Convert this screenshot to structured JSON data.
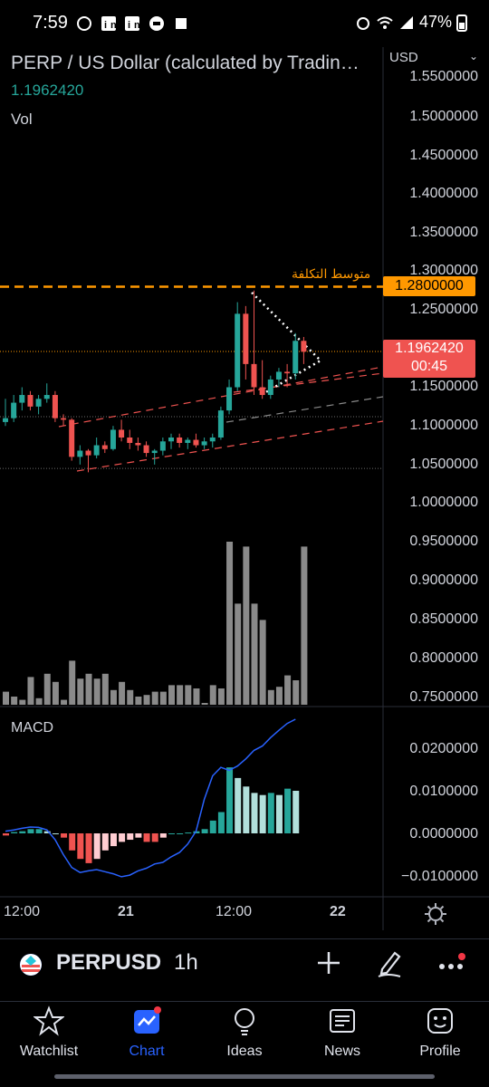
{
  "status_bar": {
    "time": "7:59",
    "notification_icons": [
      "whatsapp-icon",
      "linkedin-icon",
      "linkedin-icon",
      "message-icon",
      "puzzle-icon"
    ],
    "battery": "47%"
  },
  "chart": {
    "title": "PERP / US Dollar (calculated by Tradin…",
    "last_price": "1.1962420",
    "volume_label": "Vol",
    "macd_label": "MACD",
    "currency": "USD",
    "cost_label": "متوسط التكلفة",
    "cost_price": "1.2800000",
    "last_badge_price": "1.1962420",
    "countdown": "00:45",
    "price_axis": [
      "1.5500000",
      "1.5000000",
      "1.4500000",
      "1.4000000",
      "1.3500000",
      "1.3000000",
      "1.2500000",
      "1.1500000",
      "1.1000000",
      "1.0500000",
      "1.0000000",
      "0.9500000",
      "0.9000000",
      "0.8500000",
      "0.8000000",
      "0.7500000"
    ],
    "macd_axis": [
      "0.0200000",
      "0.0100000",
      "0.0000000",
      "−0.0100000"
    ],
    "time_axis": [
      "12:00",
      "21",
      "12:00",
      "22"
    ],
    "colors": {
      "up": "#26a69a",
      "down": "#ef5350",
      "cost": "#ff9800",
      "macd_line": "#2962ff"
    }
  },
  "chart_data": {
    "type": "candlestick",
    "symbol": "PERPUSD",
    "interval": "1h",
    "price_ylim": [
      0.75,
      1.55
    ],
    "candles": [
      {
        "o": 1.105,
        "h": 1.135,
        "l": 1.1,
        "c": 1.11
      },
      {
        "o": 1.11,
        "h": 1.14,
        "l": 1.105,
        "c": 1.13
      },
      {
        "o": 1.13,
        "h": 1.15,
        "l": 1.12,
        "c": 1.14
      },
      {
        "o": 1.14,
        "h": 1.145,
        "l": 1.12,
        "c": 1.125
      },
      {
        "o": 1.125,
        "h": 1.14,
        "l": 1.115,
        "c": 1.135
      },
      {
        "o": 1.135,
        "h": 1.155,
        "l": 1.13,
        "c": 1.14
      },
      {
        "o": 1.14,
        "h": 1.145,
        "l": 1.105,
        "c": 1.11
      },
      {
        "o": 1.11,
        "h": 1.115,
        "l": 1.1,
        "c": 1.108
      },
      {
        "o": 1.108,
        "h": 1.11,
        "l": 1.055,
        "c": 1.06
      },
      {
        "o": 1.06,
        "h": 1.075,
        "l": 1.05,
        "c": 1.068
      },
      {
        "o": 1.068,
        "h": 1.07,
        "l": 1.04,
        "c": 1.062
      },
      {
        "o": 1.062,
        "h": 1.085,
        "l": 1.058,
        "c": 1.075
      },
      {
        "o": 1.075,
        "h": 1.08,
        "l": 1.065,
        "c": 1.07
      },
      {
        "o": 1.07,
        "h": 1.1,
        "l": 1.068,
        "c": 1.095
      },
      {
        "o": 1.095,
        "h": 1.108,
        "l": 1.08,
        "c": 1.085
      },
      {
        "o": 1.085,
        "h": 1.095,
        "l": 1.07,
        "c": 1.078
      },
      {
        "o": 1.078,
        "h": 1.085,
        "l": 1.068,
        "c": 1.075
      },
      {
        "o": 1.075,
        "h": 1.08,
        "l": 1.06,
        "c": 1.065
      },
      {
        "o": 1.065,
        "h": 1.07,
        "l": 1.05,
        "c": 1.068
      },
      {
        "o": 1.068,
        "h": 1.085,
        "l": 1.062,
        "c": 1.08
      },
      {
        "o": 1.08,
        "h": 1.09,
        "l": 1.07,
        "c": 1.085
      },
      {
        "o": 1.085,
        "h": 1.09,
        "l": 1.072,
        "c": 1.078
      },
      {
        "o": 1.078,
        "h": 1.085,
        "l": 1.07,
        "c": 1.082
      },
      {
        "o": 1.082,
        "h": 1.09,
        "l": 1.072,
        "c": 1.075
      },
      {
        "o": 1.075,
        "h": 1.085,
        "l": 1.07,
        "c": 1.08
      },
      {
        "o": 1.08,
        "h": 1.09,
        "l": 1.072,
        "c": 1.085
      },
      {
        "o": 1.085,
        "h": 1.125,
        "l": 1.082,
        "c": 1.12
      },
      {
        "o": 1.12,
        "h": 1.16,
        "l": 1.115,
        "c": 1.15
      },
      {
        "o": 1.15,
        "h": 1.26,
        "l": 1.145,
        "c": 1.245
      },
      {
        "o": 1.245,
        "h": 1.255,
        "l": 1.16,
        "c": 1.18
      },
      {
        "o": 1.18,
        "h": 1.275,
        "l": 1.14,
        "c": 1.15
      },
      {
        "o": 1.15,
        "h": 1.185,
        "l": 1.135,
        "c": 1.14
      },
      {
        "o": 1.14,
        "h": 1.165,
        "l": 1.135,
        "c": 1.16
      },
      {
        "o": 1.16,
        "h": 1.175,
        "l": 1.15,
        "c": 1.17
      },
      {
        "o": 1.17,
        "h": 1.18,
        "l": 1.15,
        "c": 1.168
      },
      {
        "o": 1.168,
        "h": 1.22,
        "l": 1.16,
        "c": 1.21
      },
      {
        "o": 1.21,
        "h": 1.215,
        "l": 1.18,
        "c": 1.196
      }
    ],
    "volume": [
      0.08,
      0.05,
      0.03,
      0.17,
      0.04,
      0.19,
      0.14,
      0.03,
      0.27,
      0.16,
      0.19,
      0.16,
      0.19,
      0.09,
      0.14,
      0.09,
      0.05,
      0.06,
      0.08,
      0.08,
      0.12,
      0.12,
      0.12,
      0.1,
      0.01,
      0.12,
      0.1,
      1.0,
      0.62,
      0.97,
      0.62,
      0.52,
      0.09,
      0.11,
      0.18,
      0.15,
      0.97
    ],
    "macd_ylim": [
      -0.0125,
      0.027
    ],
    "macd_histogram": [
      -0.0005,
      0.0003,
      0.0005,
      0.001,
      0.001,
      0.0005,
      0.0,
      -0.001,
      -0.004,
      -0.006,
      -0.007,
      -0.006,
      -0.004,
      -0.003,
      -0.002,
      -0.0015,
      -0.001,
      -0.002,
      -0.002,
      -0.001,
      0.0,
      0.0,
      0.0002,
      0.0005,
      0.001,
      0.003,
      0.005,
      0.0155,
      0.013,
      0.011,
      0.0095,
      0.009,
      0.0095,
      0.009,
      0.0105,
      0.01
    ],
    "macd_line": [
      0.0005,
      0.0008,
      0.0012,
      0.0015,
      0.0014,
      0.0008,
      -0.0015,
      -0.005,
      -0.008,
      -0.0092,
      -0.0088,
      -0.0085,
      -0.009,
      -0.0095,
      -0.0102,
      -0.0098,
      -0.0088,
      -0.0082,
      -0.0072,
      -0.0068,
      -0.0055,
      -0.0045,
      -0.0025,
      0.0005,
      0.008,
      0.0135,
      0.0155,
      0.0148,
      0.0158,
      0.0175,
      0.0195,
      0.0205,
      0.0225,
      0.0242,
      0.0258,
      0.0268
    ],
    "cost_price": 1.28,
    "last_price": 1.196242
  },
  "toolbar": {
    "symbol": "PERPUSD",
    "interval": "1h"
  },
  "nav": {
    "items": [
      {
        "label": "Watchlist",
        "icon": "star-icon"
      },
      {
        "label": "Chart",
        "icon": "chart-icon"
      },
      {
        "label": "Ideas",
        "icon": "lightbulb-icon"
      },
      {
        "label": "News",
        "icon": "newspaper-icon"
      },
      {
        "label": "Profile",
        "icon": "smiley-icon"
      }
    ]
  }
}
